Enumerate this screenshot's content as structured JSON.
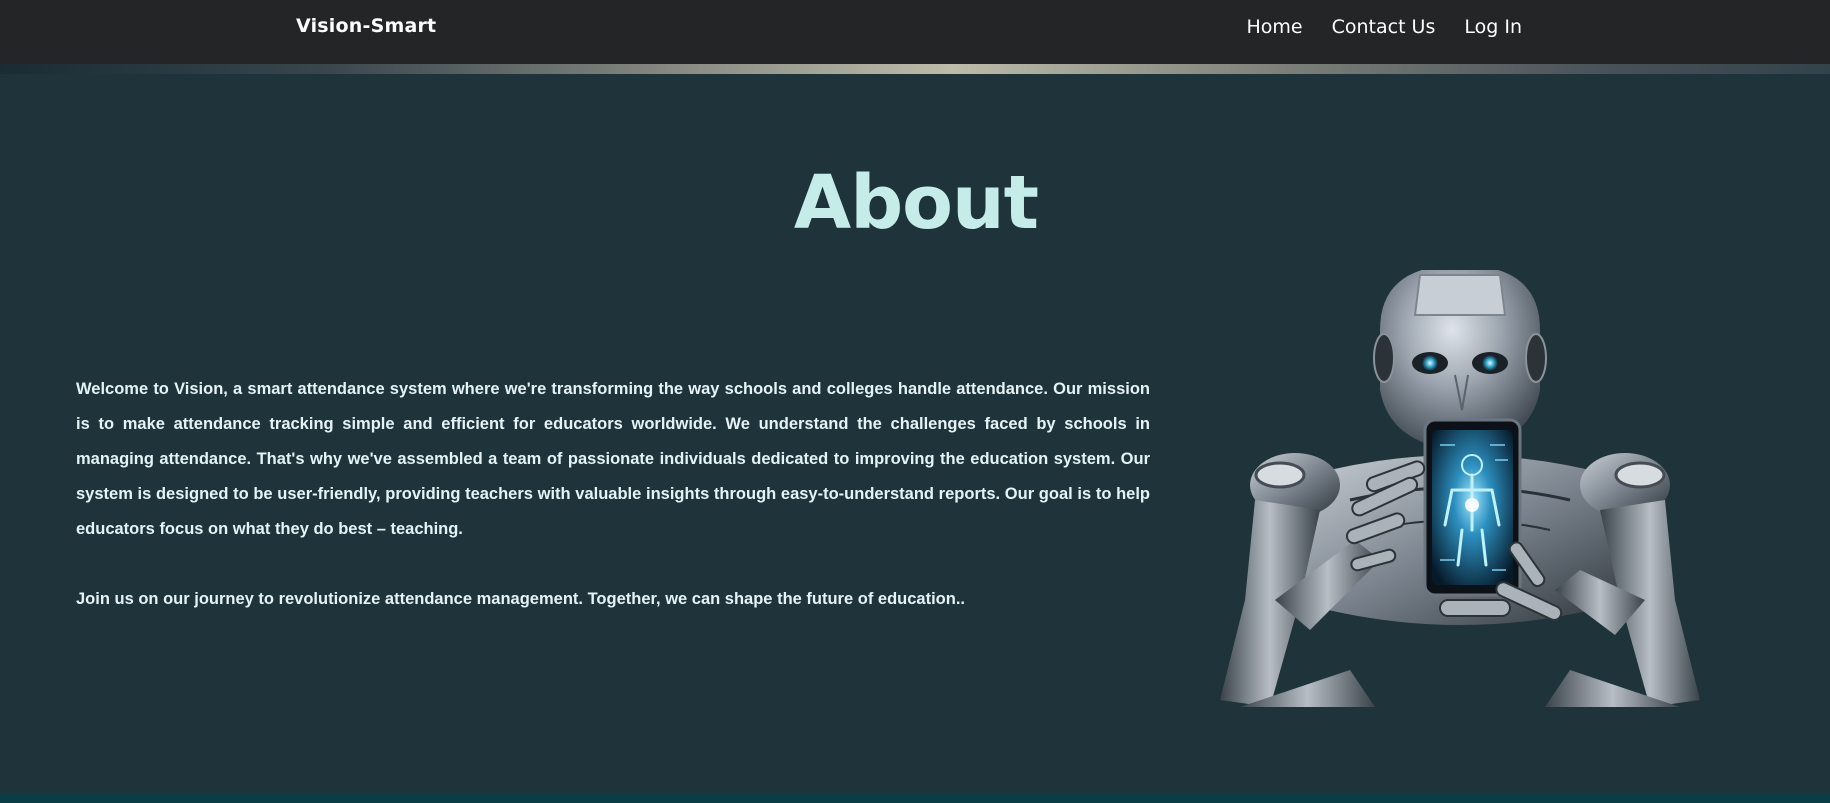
{
  "navbar": {
    "brand": "Vision-Smart",
    "links": [
      "Home",
      "Contact Us",
      "Log In"
    ]
  },
  "about": {
    "title": "About",
    "paragraphs": [
      "Welcome to Vision, a smart attendance system where we're transforming the way schools and colleges handle attendance. Our mission is to make attendance tracking simple and efficient for educators worldwide. We understand the challenges faced by schools in managing attendance. That's why we've assembled a team of passionate individuals dedicated to improving the education system. Our system is designed to be user-friendly, providing teachers with valuable insights through easy-to-understand reports. Our goal is to help educators focus on what they do best – teaching.",
      "Join us on our journey to revolutionize attendance management. Together, we can shape the future of education.."
    ]
  },
  "colors": {
    "page_bg": "#1f333b",
    "navbar_bg": "#242526",
    "title": "#c6ecea",
    "body_text": "#e4f3f6",
    "footer_bar": "#0b3d47"
  },
  "icons": {
    "hero_image": "robot-holding-phone-illustration"
  }
}
